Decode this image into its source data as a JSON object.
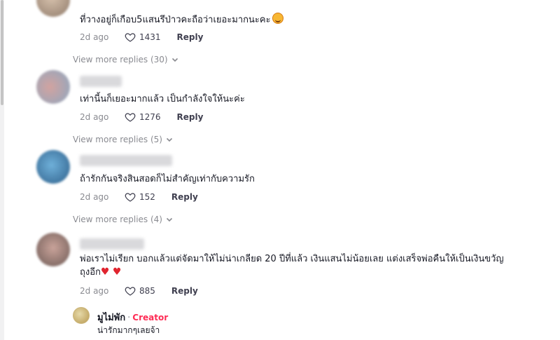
{
  "comments": [
    {
      "text": "ที่วางอยู่ก็เกือบ5แสนรึป่าวคะถือว่าเยอะมากนะคะ",
      "emoji": "smiling-face-with-hearts-emoji",
      "date": "2d ago",
      "likes": "1431",
      "reply_label": "Reply",
      "view_more": "View more replies (30)"
    },
    {
      "text": "เท่านี้นก็เยอะมากแล้ว เป็นกำลังใจให้นะค่ะ",
      "date": "2d ago",
      "likes": "1276",
      "reply_label": "Reply",
      "view_more": "View more replies (5)"
    },
    {
      "text": "ถ้ารักกันจริงสินสอดก็ไม่สำคัญเท่ากับความรัก",
      "date": "2d ago",
      "likes": "152",
      "reply_label": "Reply",
      "view_more": "View more replies (4)"
    },
    {
      "text_line1": "พ่อเราไม่เรียก บอกแล้วแต่จัดมาให้ไม่น่าเกลียด 20 ปีที่แล้ว เงินแสนไม่น้อยเลย แต่งเสร็จพ่อคืนให้เป็นเงินขวัญ",
      "text_line2": "ถุงอีก",
      "emoji": "red-heart-emoji",
      "date": "2d ago",
      "likes": "885",
      "reply_label": "Reply"
    }
  ],
  "creator_reply": {
    "name": "มูไม่พัก",
    "separator": "·",
    "badge": "Creator",
    "text": "น่ารักมากๆเลยจ้า"
  },
  "colors": {
    "accent": "#fe2c55",
    "muted": "#8a8b91",
    "heart_emoji": "#e0242e"
  }
}
